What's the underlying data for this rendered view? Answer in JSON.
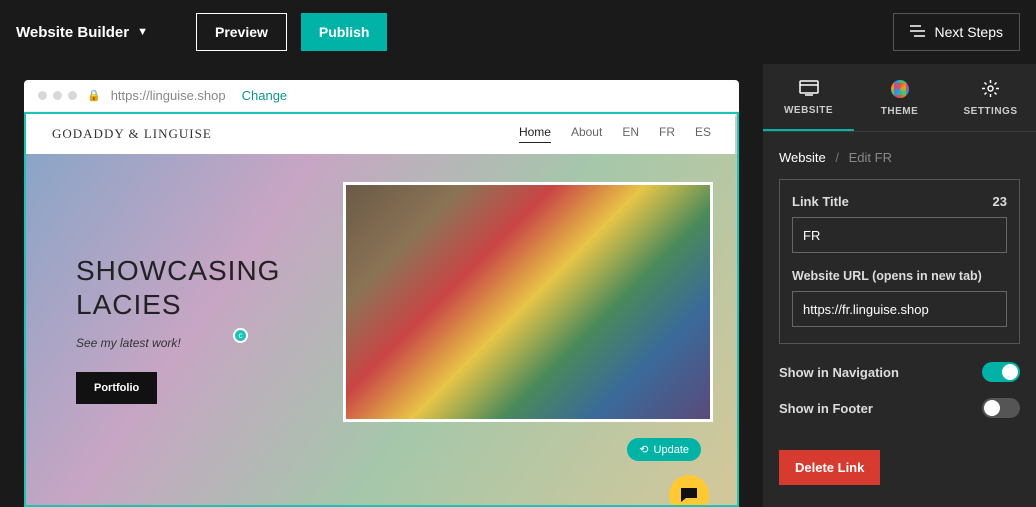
{
  "header": {
    "brand": "Website Builder",
    "preview": "Preview",
    "publish": "Publish",
    "next_steps": "Next Steps"
  },
  "canvas": {
    "url": "https://linguise.shop",
    "change": "Change",
    "site_logo": "GODADDY & LINGUISE",
    "nav": [
      "Home",
      "About",
      "EN",
      "FR",
      "ES"
    ],
    "hero_title_1": "SHOWCASING",
    "hero_title_2": "LACIES",
    "hero_sub": "See my latest work!",
    "hero_btn": "Portfolio",
    "update": "Update"
  },
  "sidebar": {
    "tabs": {
      "website": "WEBSITE",
      "theme": "THEME",
      "settings": "SETTINGS"
    },
    "breadcrumb_root": "Website",
    "breadcrumb_current": "Edit FR",
    "link_title_label": "Link Title",
    "link_title_count": "23",
    "link_title_value": "FR",
    "url_label": "Website URL (opens in new tab)",
    "url_value": "https://fr.linguise.shop",
    "show_nav": "Show in Navigation",
    "show_footer": "Show in Footer",
    "delete": "Delete Link"
  }
}
